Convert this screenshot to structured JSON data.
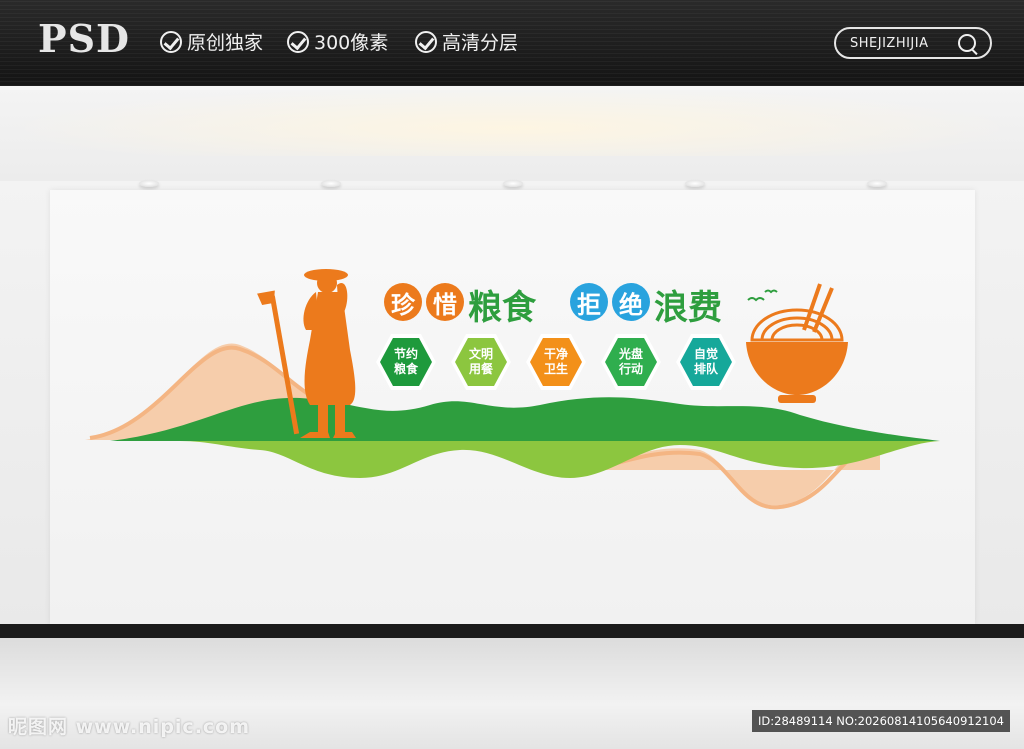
{
  "header": {
    "logo_text": "PSD",
    "features": [
      "原创独家",
      "300像素",
      "高清分层"
    ],
    "search_label": "SHEJIZHIJIA"
  },
  "slogan": {
    "chars_circled": [
      "珍",
      "惜",
      "拒",
      "绝"
    ],
    "word_1": "粮食",
    "word_2": "浪费"
  },
  "hexagons": [
    {
      "line1": "节约",
      "line2": "粮食",
      "color": "#1e9a3c"
    },
    {
      "line1": "文明",
      "line2": "用餐",
      "color": "#8cc63f"
    },
    {
      "line1": "干净",
      "line2": "卫生",
      "color": "#f39019"
    },
    {
      "line1": "光盘",
      "line2": "行动",
      "color": "#2fae4e"
    },
    {
      "line1": "自觉",
      "line2": "排队",
      "color": "#16a89a"
    }
  ],
  "colors": {
    "orange": "#ec7a1c",
    "green_dark": "#1e9a3c",
    "green_light": "#8cc63f",
    "blue": "#29a3de",
    "peach": "#f6c9a3"
  },
  "footer": {
    "watermark_left": "昵图网 www.nipic.com",
    "watermark_right": "ID:28489114 NO:20260814105640912104"
  }
}
